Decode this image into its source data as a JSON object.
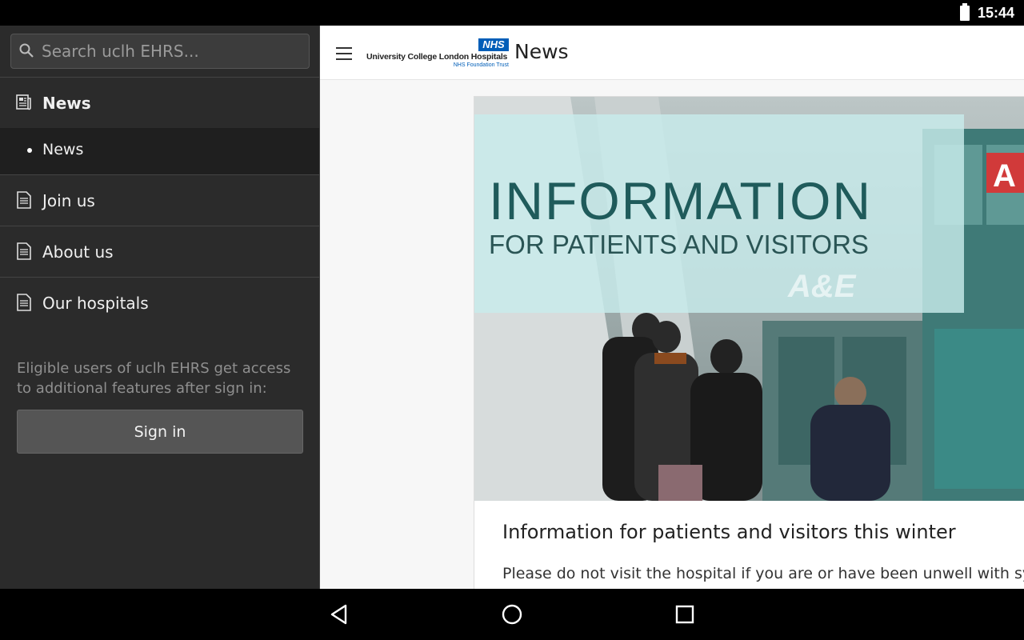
{
  "status_bar": {
    "time": "15:44"
  },
  "drawer": {
    "search_placeholder": "Search uclh EHRS...",
    "items": [
      {
        "label": "News",
        "icon": "news-icon"
      },
      {
        "label": "News"
      },
      {
        "label": "Join us",
        "icon": "document-icon"
      },
      {
        "label": "About us",
        "icon": "document-icon"
      },
      {
        "label": "Our hospitals",
        "icon": "document-icon"
      }
    ],
    "note": "Eligible users of uclh EHRS get access to additional features after sign in:",
    "sign_in_label": "Sign in"
  },
  "app_bar": {
    "logo": {
      "nhs": "NHS",
      "trust_name": "University College London Hospitals",
      "foundation": "NHS Foundation Trust"
    },
    "title": "News"
  },
  "article": {
    "hero": {
      "headline": "INFORMATION",
      "subline": "FOR PATIENTS AND VISITORS",
      "sign": "A&E"
    },
    "title": "Information for patients and visitors this winter",
    "excerpt": "Please do not visit the hospital if you are or have been unwell with sym"
  },
  "colors": {
    "drawer_bg": "#2b2b2b",
    "nhs_blue": "#005eb8",
    "hero_teal": "#1f5b5b"
  }
}
